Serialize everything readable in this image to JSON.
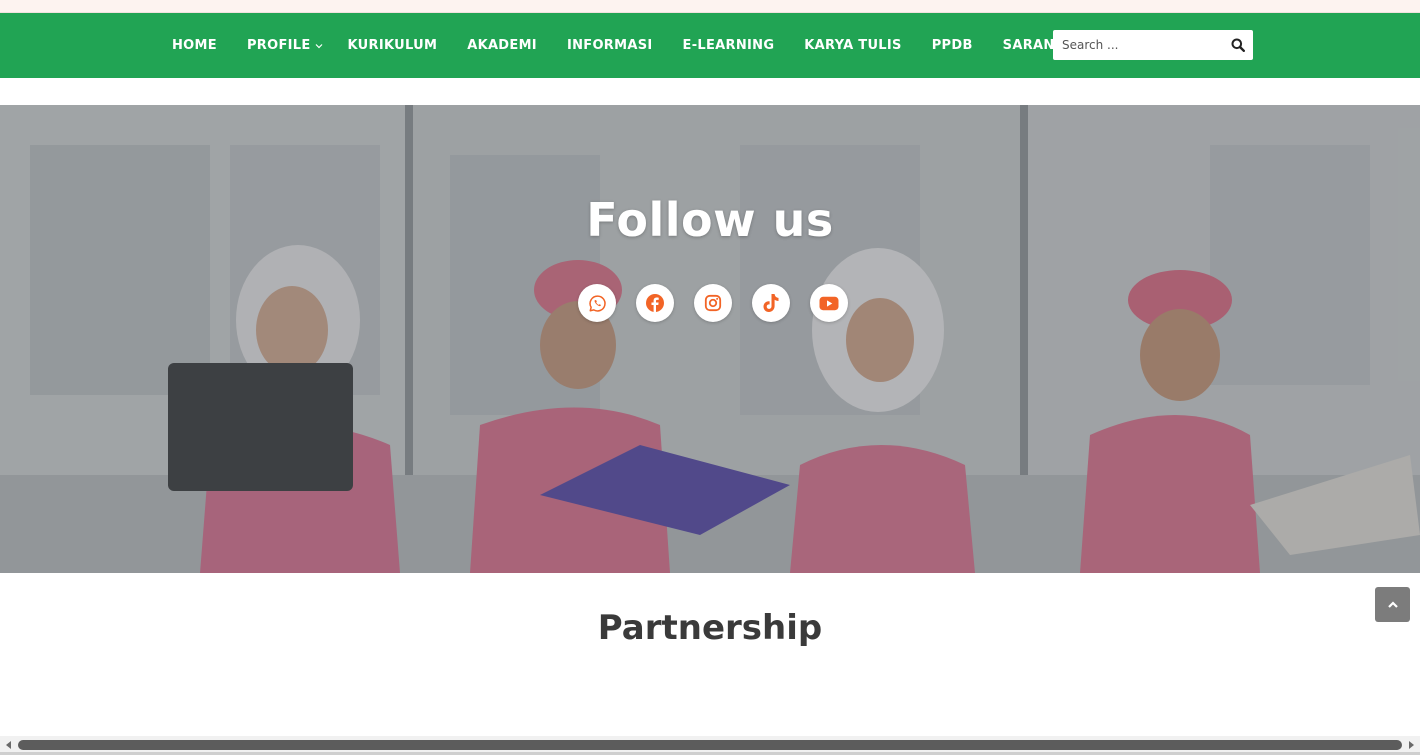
{
  "colors": {
    "nav_bg": "#21a454",
    "accent_icon": "#f26426",
    "hero_overlay": "rgba(90,96,100,0.45)",
    "section_title": "#3a3a3a",
    "back_to_top_bg": "#7c7c7c"
  },
  "nav": {
    "items": [
      {
        "label": "HOME"
      },
      {
        "label": "PROFILE",
        "has_submenu": true
      },
      {
        "label": "KURIKULUM"
      },
      {
        "label": "AKADEMI"
      },
      {
        "label": "INFORMASI"
      },
      {
        "label": "E-LEARNING"
      },
      {
        "label": "KARYA TULIS"
      },
      {
        "label": "PPDB"
      },
      {
        "label": "SARANA"
      }
    ],
    "search": {
      "placeholder": "Search ...",
      "icon": "search-icon"
    }
  },
  "hero": {
    "title": "Follow us",
    "social_icons": [
      "whatsapp-icon",
      "facebook-icon",
      "instagram-icon",
      "tiktok-icon",
      "youtube-icon"
    ]
  },
  "partnership": {
    "title": "Partnership"
  },
  "back_to_top": {
    "icon": "chevron-up-icon"
  }
}
